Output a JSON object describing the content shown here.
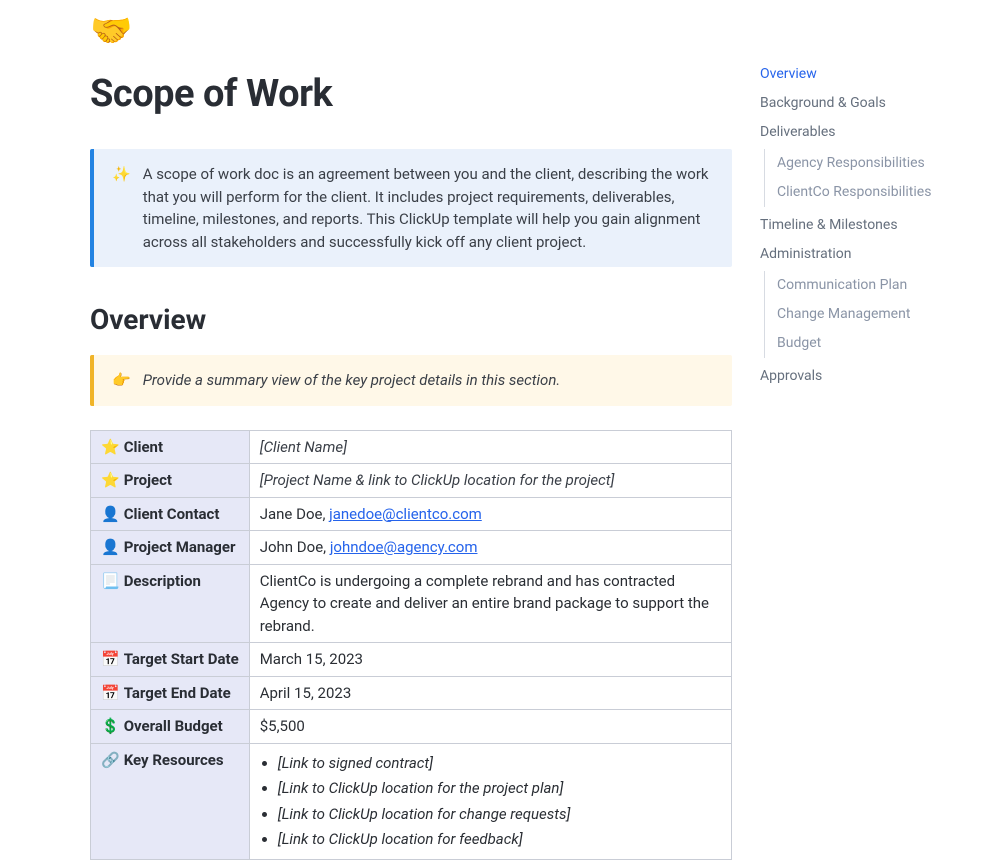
{
  "header": {
    "icon": "🤝",
    "title": "Scope of Work"
  },
  "intro_callout": {
    "icon": "✨",
    "body": "A scope of work doc is an agreement between you and the client, describing the work that you will perform for the client. It includes project requirements, deliverables, timeline, milestones, and reports. This ClickUp template will help you gain alignment across all stakeholders and successfully kick off any client project."
  },
  "overview": {
    "heading": "Overview",
    "hint_icon": "👉",
    "hint_body": "Provide a summary view of the key project details in this section."
  },
  "table": {
    "rows": [
      {
        "icon": "⭐",
        "label": "Client",
        "kind": "placeholder",
        "value": "[Client Name]"
      },
      {
        "icon": "⭐",
        "label": "Project",
        "kind": "placeholder",
        "value": "[Project Name & link to ClickUp location for the project]"
      },
      {
        "icon": "👤",
        "label": "Client Contact",
        "kind": "contact",
        "name": "Jane Doe",
        "email": "janedoe@clientco.com"
      },
      {
        "icon": "👤",
        "label": "Project Manager",
        "kind": "contact",
        "name": "John Doe",
        "email": "johndoe@agency.com"
      },
      {
        "icon": "📃",
        "label": "Description",
        "kind": "text",
        "value": "ClientCo is undergoing a complete rebrand and has contracted Agency to create and deliver an entire brand package to support the rebrand."
      },
      {
        "icon": "📅",
        "label": "Target Start Date",
        "kind": "text",
        "value": "March 15, 2023"
      },
      {
        "icon": "📅",
        "label": "Target End Date",
        "kind": "text",
        "value": "April 15, 2023"
      },
      {
        "icon": "💲",
        "label": "Overall Budget",
        "kind": "text",
        "value": "$5,500"
      },
      {
        "icon": "🔗",
        "label": "Key Resources",
        "kind": "list",
        "items": [
          "[Link to signed contract]",
          "[Link to ClickUp location for the project plan]",
          "[Link to ClickUp location for change requests]",
          "[Link to ClickUp location for feedback]"
        ]
      }
    ]
  },
  "toc": [
    {
      "label": "Overview",
      "active": true
    },
    {
      "label": "Background & Goals"
    },
    {
      "label": "Deliverables",
      "children": [
        {
          "label": "Agency Responsibilities"
        },
        {
          "label": "ClientCo Responsibilities"
        }
      ]
    },
    {
      "label": "Timeline & Milestones"
    },
    {
      "label": "Administration",
      "children": [
        {
          "label": "Communication Plan"
        },
        {
          "label": "Change Management"
        },
        {
          "label": "Budget"
        }
      ]
    },
    {
      "label": "Approvals"
    }
  ]
}
